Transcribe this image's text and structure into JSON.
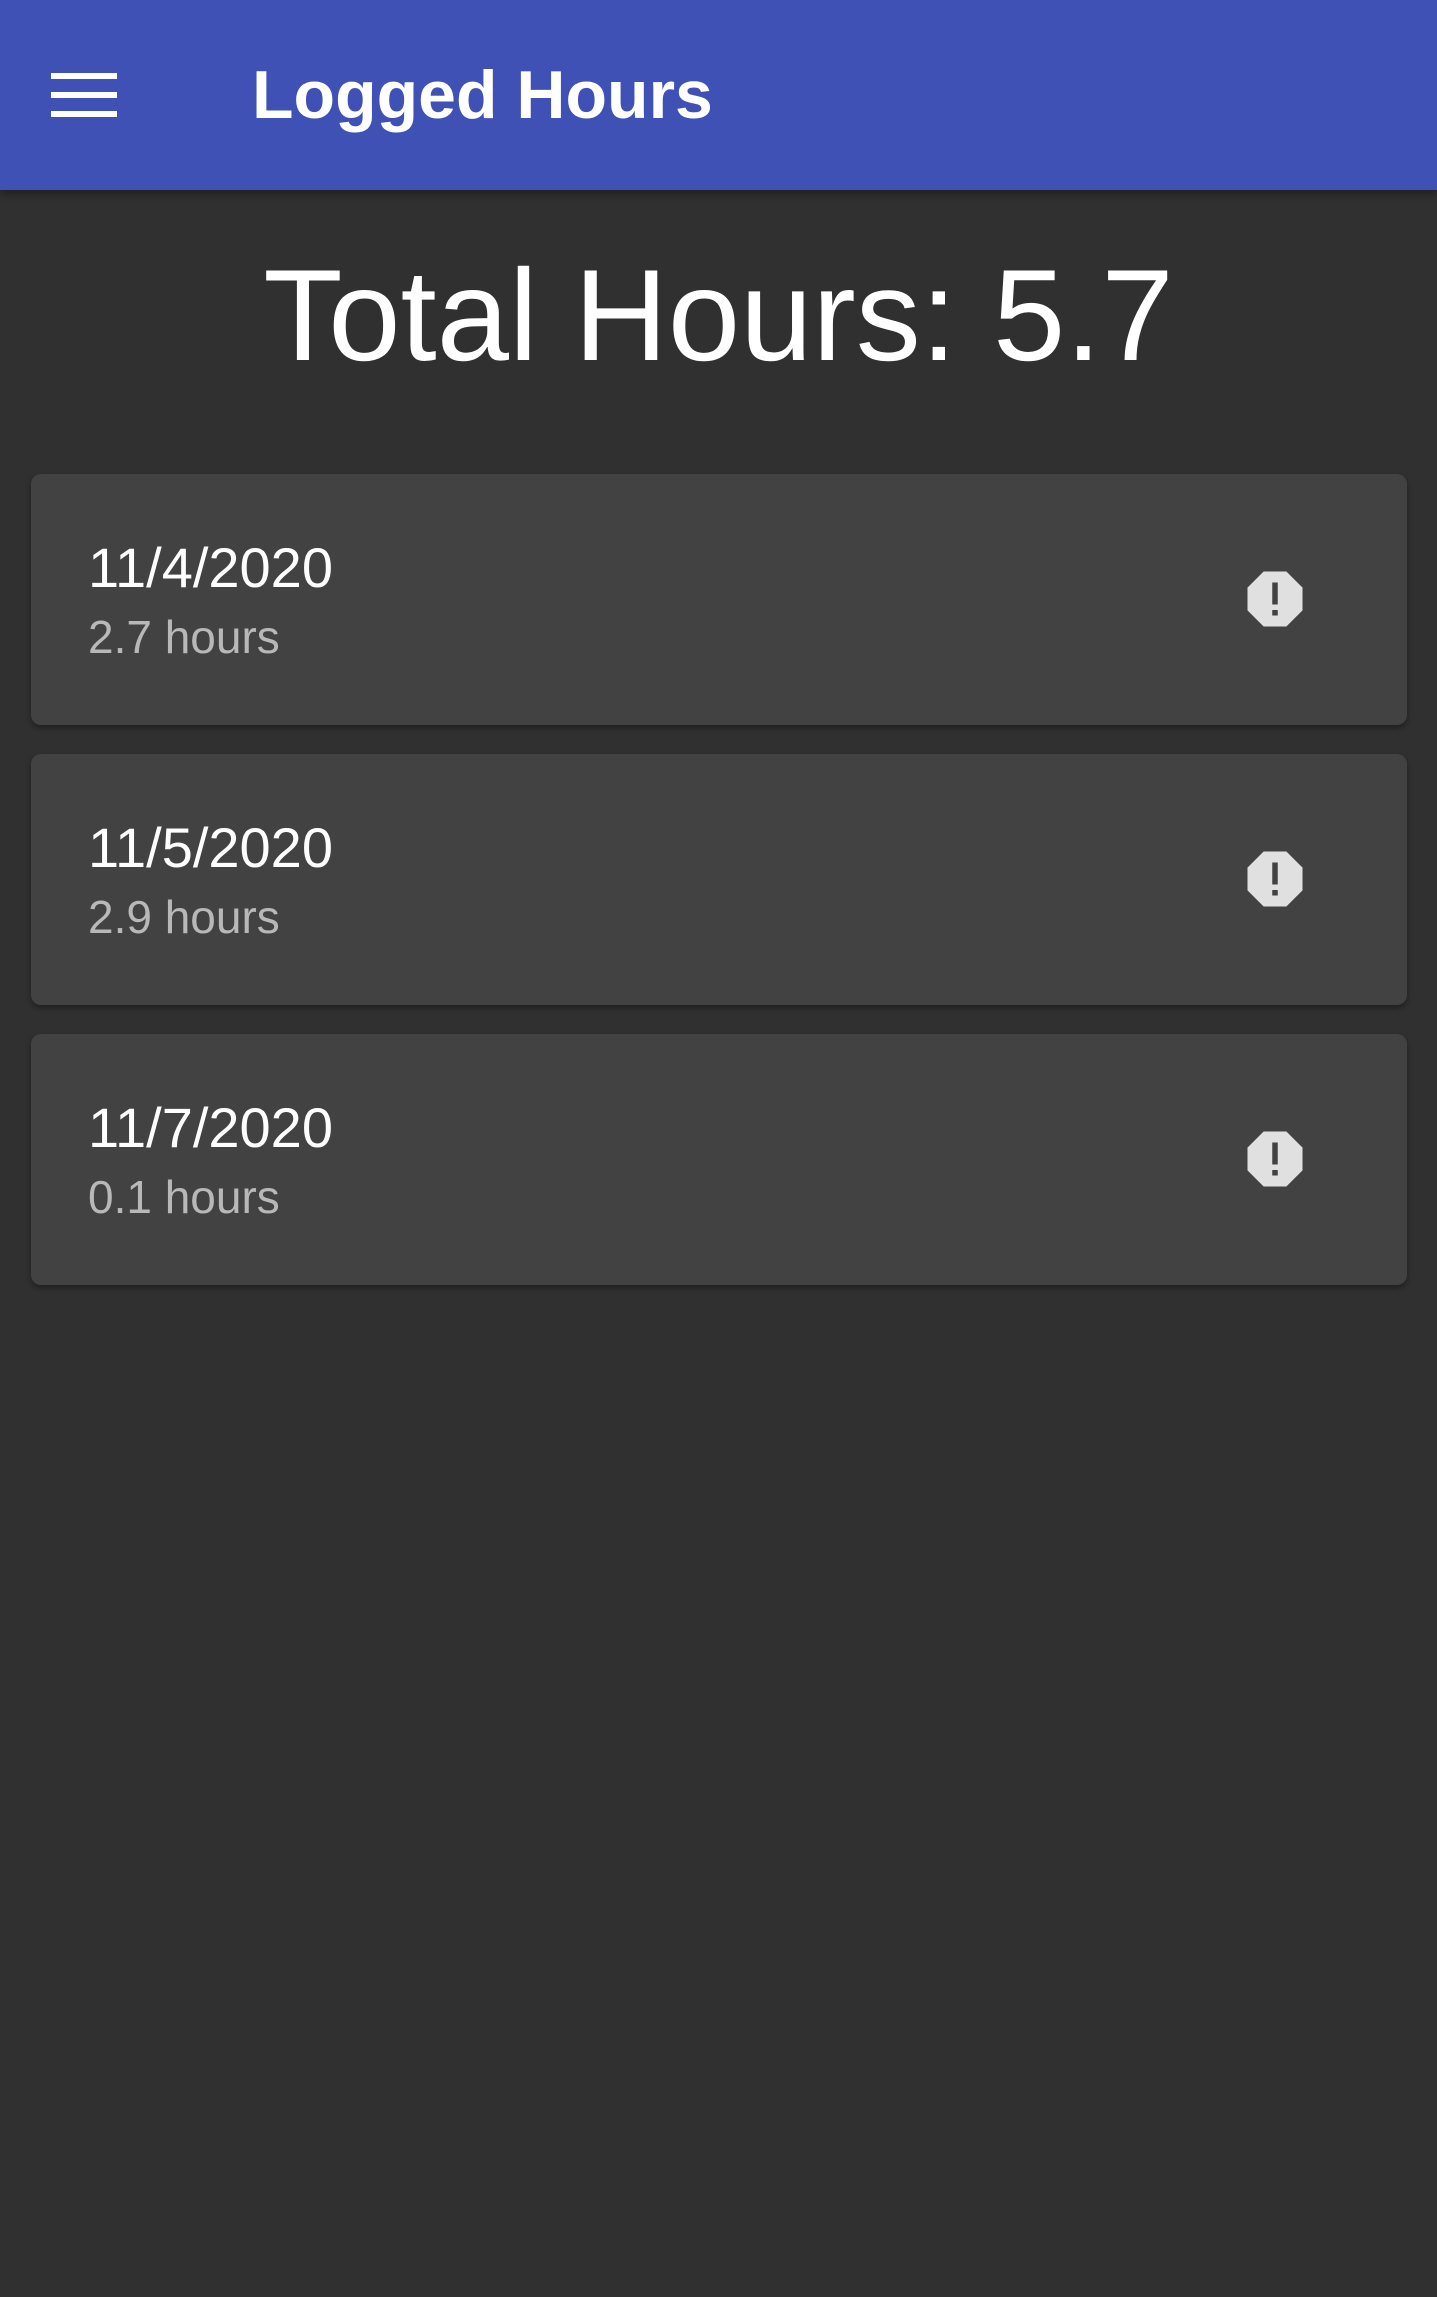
{
  "app_bar": {
    "title": "Logged Hours",
    "menu_icon": "menu-icon",
    "background_color": "#3f51b5"
  },
  "summary": {
    "total_text": "Total Hours: 5.7"
  },
  "logs": [
    {
      "date": "11/4/2020",
      "hours_text": "2.7 hours",
      "icon": "report-octagon-icon"
    },
    {
      "date": "11/5/2020",
      "hours_text": "2.9 hours",
      "icon": "report-octagon-icon"
    },
    {
      "date": "11/7/2020",
      "hours_text": "0.1 hours",
      "icon": "report-octagon-icon"
    }
  ],
  "colors": {
    "background": "#303030",
    "card": "#424242",
    "primary_text": "#ffffff",
    "secondary_text": "#b8b8b8",
    "icon": "#e0e0e0"
  }
}
